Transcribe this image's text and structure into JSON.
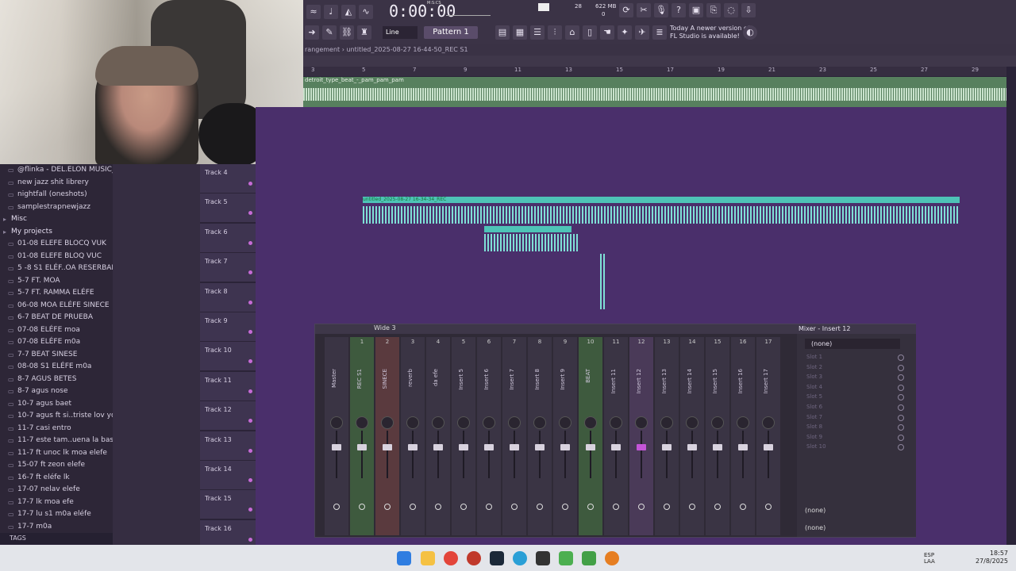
{
  "toolbar": {
    "time": "0:00:00",
    "time_label": "M:S:CS",
    "cpu_label": "28",
    "mem_label": "622 MB",
    "mem_count": "0",
    "snap_mode": "Line",
    "pattern": "Pattern 1",
    "notice_line1": "Today  A newer version of",
    "notice_line2": "FL Studio is available!"
  },
  "playlist": {
    "breadcrumb": "rangement › untitled_2025-08-27 16-44-50_REC S1",
    "track1_clip": "detroit_type_beat_-_pam_pam_pam",
    "ruler": [
      "3",
      "5",
      "7",
      "9",
      "11",
      "13",
      "15",
      "17",
      "19",
      "21",
      "23",
      "25",
      "27",
      "29"
    ],
    "tracks": [
      "Track 4",
      "Track 5",
      "Track 6",
      "Track 7",
      "Track 8",
      "Track 9",
      "Track 10",
      "Track 11",
      "Track 12",
      "Track 13",
      "Track 14",
      "Track 15",
      "Track 16"
    ],
    "clip_label": "untitled_2025-08-27 16-34-34_REC"
  },
  "sidebar": {
    "items": [
      {
        "label": "@flinka - DEL.ELON MUSIC_",
        "cat": false
      },
      {
        "label": "new jazz shit librery",
        "cat": false
      },
      {
        "label": "nightfall (oneshots)",
        "cat": false
      },
      {
        "label": "samplestrapnewjazz",
        "cat": false
      },
      {
        "label": "Misc",
        "cat": true
      },
      {
        "label": "My projects",
        "cat": true
      },
      {
        "label": "01-08 ELEFE BLOCQ VUK",
        "cat": false
      },
      {
        "label": "01-08 ELEFE BLOQ VUC",
        "cat": false
      },
      {
        "label": "5 -8 S1 ELÉF..OA RESERBADO",
        "cat": false
      },
      {
        "label": "5-7 FT. MOA",
        "cat": false
      },
      {
        "label": "5-7 FT. RAMMA ELÉFE",
        "cat": false
      },
      {
        "label": "06-08 MOA ELÉFE SINECE",
        "cat": false
      },
      {
        "label": "6-7 BEAT DE PRUEBA",
        "cat": false
      },
      {
        "label": "07-08  ELÉFE moa",
        "cat": false
      },
      {
        "label": "07-08 ELÉFE m0a",
        "cat": false
      },
      {
        "label": "7-7 BEAT SINESE",
        "cat": false
      },
      {
        "label": "08-08 S1 ELÉFE m0a",
        "cat": false
      },
      {
        "label": "8-7 AGUS BETES",
        "cat": false
      },
      {
        "label": "8-7 agus nose",
        "cat": false
      },
      {
        "label": "10-7 agus baet",
        "cat": false
      },
      {
        "label": "10-7 agus ft si..triste lov you",
        "cat": false
      },
      {
        "label": "11-7 casi entro",
        "cat": false
      },
      {
        "label": "11-7 este tam..uena la base",
        "cat": false
      },
      {
        "label": "11-7 ft unoc lk moa elefe",
        "cat": false
      },
      {
        "label": "15-07 ft zeon elefe",
        "cat": false
      },
      {
        "label": "16-7 ft eléfe lk",
        "cat": false
      },
      {
        "label": "17-07 nelav elefe",
        "cat": false
      },
      {
        "label": "17-7 lk moa efe",
        "cat": false
      },
      {
        "label": "17-7 lu s1 m0a eléfe",
        "cat": false
      },
      {
        "label": "17-7 m0a",
        "cat": false
      }
    ],
    "tags_label": "TAGS"
  },
  "mixer": {
    "title": "Wide 3",
    "panel_title": "Mixer - Insert 12",
    "none_label": "(none)",
    "strips": [
      {
        "num": "",
        "name": "Master"
      },
      {
        "num": "1",
        "name": "REC S1"
      },
      {
        "num": "2",
        "name": "SINECE"
      },
      {
        "num": "3",
        "name": "reverb"
      },
      {
        "num": "4",
        "name": "da efe"
      },
      {
        "num": "5",
        "name": "Insert 5"
      },
      {
        "num": "6",
        "name": "Insert 6"
      },
      {
        "num": "7",
        "name": "Insert 7"
      },
      {
        "num": "8",
        "name": "Insert 8"
      },
      {
        "num": "9",
        "name": "Insert 9"
      },
      {
        "num": "10",
        "name": "BEAT"
      },
      {
        "num": "11",
        "name": "Insert 11"
      },
      {
        "num": "12",
        "name": "Insert 12"
      },
      {
        "num": "13",
        "name": "Insert 13"
      },
      {
        "num": "14",
        "name": "Insert 14"
      },
      {
        "num": "15",
        "name": "Insert 15"
      },
      {
        "num": "16",
        "name": "Insert 16"
      },
      {
        "num": "17",
        "name": "Insert 17"
      }
    ],
    "slots": [
      "Slot 1",
      "Slot 2",
      "Slot 3",
      "Slot 4",
      "Slot 5",
      "Slot 6",
      "Slot 7",
      "Slot 8",
      "Slot 9",
      "Slot 10"
    ]
  },
  "taskbar": {
    "lang1": "ESP",
    "lang2": "LAA",
    "time": "18:57",
    "date": "27/8/2025"
  }
}
